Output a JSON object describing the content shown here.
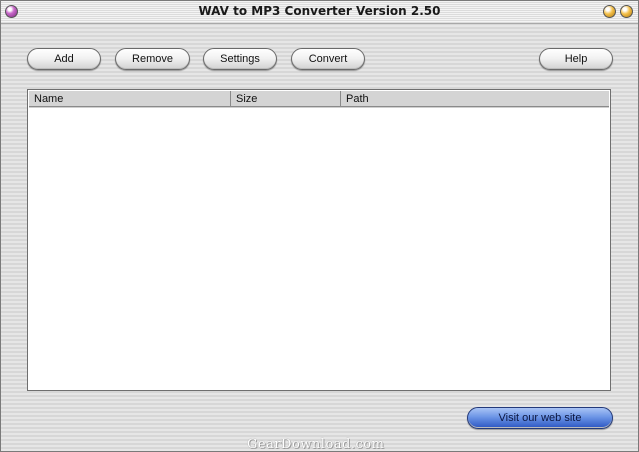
{
  "window": {
    "title": "WAV to MP3 Converter Version 2.50"
  },
  "toolbar": {
    "add_label": "Add",
    "remove_label": "Remove",
    "settings_label": "Settings",
    "convert_label": "Convert",
    "help_label": "Help"
  },
  "file_list": {
    "columns": [
      "Name",
      "Size",
      "Path"
    ],
    "rows": []
  },
  "footer": {
    "website_label": "Visit our web site",
    "watermark": "GearDownload.com"
  },
  "colors": {
    "title_menu_orb": "#c96acb",
    "title_window_orbs": "#f4c04a",
    "website_button": "#2b56c2"
  }
}
